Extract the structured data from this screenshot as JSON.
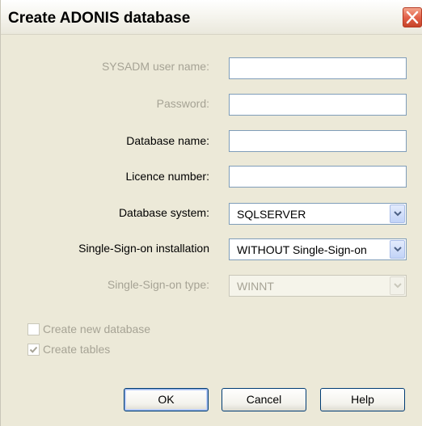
{
  "window": {
    "title": "Create ADONIS database"
  },
  "form": {
    "sysadm_label": "SYSADM user name:",
    "sysadm_value": "",
    "password_label": "Password:",
    "password_value": "",
    "dbname_label": "Database name:",
    "dbname_value": "",
    "licence_label": "Licence number:",
    "licence_value": "",
    "dbsystem_label": "Database system:",
    "dbsystem_value": "SQLSERVER",
    "sso_install_label": "Single-Sign-on installation",
    "sso_install_value": "WITHOUT Single-Sign-on",
    "sso_type_label": "Single-Sign-on type:",
    "sso_type_value": "WINNT"
  },
  "options": {
    "create_db_label": "Create new database",
    "create_db_checked": false,
    "create_tables_label": "Create tables",
    "create_tables_checked": true
  },
  "buttons": {
    "ok": "OK",
    "cancel": "Cancel",
    "help": "Help"
  },
  "colors": {
    "dialog_bg": "#ece9d8",
    "disabled_text": "#a6a395",
    "button_border": "#003c74",
    "close_button": "#e2614a"
  }
}
